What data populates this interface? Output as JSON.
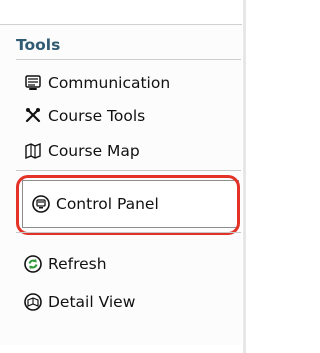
{
  "header": {
    "title": "Tools"
  },
  "items": [
    {
      "label": "Communication",
      "icon": "communication-icon"
    },
    {
      "label": "Course Tools",
      "icon": "course-tools-icon"
    },
    {
      "label": "Course Map",
      "icon": "course-map-icon"
    },
    {
      "label": "Control Panel",
      "icon": "control-panel-icon"
    },
    {
      "label": "Refresh",
      "icon": "refresh-icon"
    },
    {
      "label": "Detail View",
      "icon": "detail-view-icon"
    }
  ],
  "colors": {
    "title": "#315a73",
    "highlight": "#e33329",
    "text": "#111111",
    "panel_bg": "#fcfcfc"
  }
}
